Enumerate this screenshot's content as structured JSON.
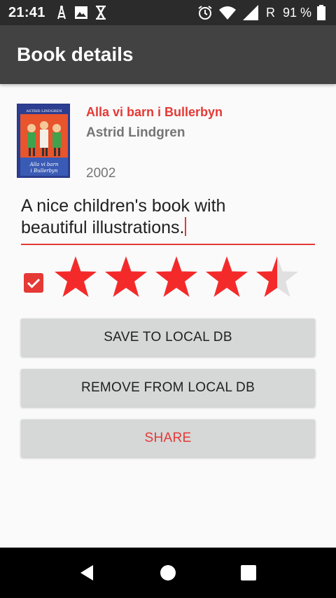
{
  "status_bar": {
    "time": "21:41",
    "roaming": "R",
    "battery_pct": "91 %",
    "icons": [
      "wifi-tower-icon",
      "image-icon",
      "hourglass-icon",
      "alarm-icon",
      "wifi-icon",
      "signal-icon",
      "battery-icon"
    ]
  },
  "app_bar": {
    "title": "Book details"
  },
  "book": {
    "title": "Alla vi barn i Bullerbyn",
    "author": "Astrid Lindgren",
    "year": "2002",
    "cover": {
      "top_text": "ASTRID LINDGREN",
      "bottom_text_1": "Alla vi barn",
      "bottom_text_2": "i Bullerbyn"
    }
  },
  "description": {
    "line1": "A nice children's book with",
    "line2": "beautiful illustrations."
  },
  "rating": {
    "checked": true,
    "stars_max": 5,
    "value": 4.5,
    "active_color": "#f42a2a",
    "inactive_color": "#e0e0e0"
  },
  "buttons": {
    "save": "SAVE TO LOCAL DB",
    "remove": "REMOVE FROM LOCAL DB",
    "share": "SHARE"
  },
  "colors": {
    "accent": "#e53935",
    "app_bar": "#424242",
    "status_bar": "#2b2b2b"
  }
}
